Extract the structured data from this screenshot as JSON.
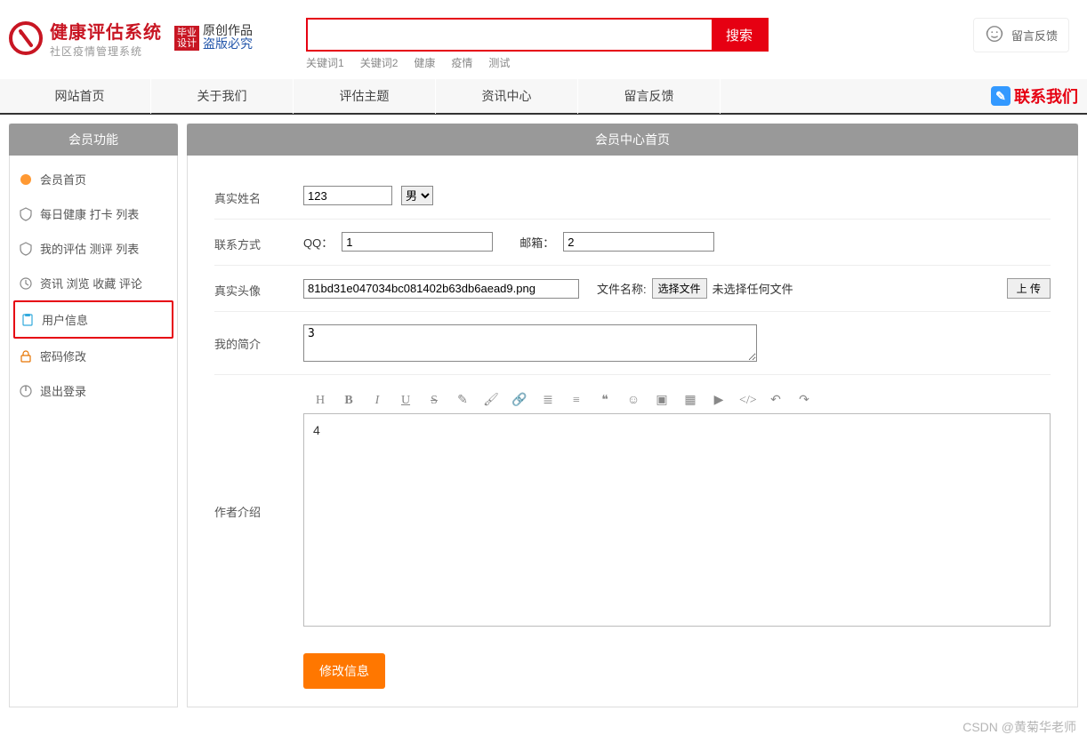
{
  "header": {
    "title": "健康评估系统",
    "subtitle": "社区疫情管理系统",
    "badge_red_l1": "毕业",
    "badge_red_l2": "设计",
    "badge_script_l1": "原创作品",
    "badge_script_l2": "盗版必究",
    "search_button": "搜索",
    "keywords": [
      "关键词1",
      "关键词2",
      "健康",
      "疫情",
      "测试"
    ],
    "feedback_label": "留言反馈"
  },
  "nav": {
    "items": [
      "网站首页",
      "关于我们",
      "评估主题",
      "资讯中心",
      "留言反馈"
    ],
    "contact": "联系我们"
  },
  "sidebar": {
    "header": "会员功能",
    "items": [
      {
        "label": "会员首页"
      },
      {
        "label": "每日健康 打卡 列表"
      },
      {
        "label": "我的评估 测评 列表"
      },
      {
        "label": "资讯 浏览 收藏 评论"
      },
      {
        "label": "用户信息"
      },
      {
        "label": "密码修改"
      },
      {
        "label": "退出登录"
      }
    ]
  },
  "content": {
    "header": "会员中心首页",
    "labels": {
      "real_name": "真实姓名",
      "contact": "联系方式",
      "avatar": "真实头像",
      "brief": "我的简介",
      "author_intro": "作者介绍",
      "qq": "QQ：",
      "email": "邮箱：",
      "file_name_label": "文件名称:",
      "choose_file": "选择文件",
      "no_file": "未选择任何文件",
      "upload": "上 传",
      "submit": "修改信息"
    },
    "values": {
      "real_name": "123",
      "gender": "男",
      "qq": "1",
      "email": "2",
      "avatar_filename": "81bd31e047034bc081402b63db6aead9.png",
      "brief": "3",
      "author_intro": "4"
    }
  },
  "watermark": "CSDN @黄菊华老师"
}
